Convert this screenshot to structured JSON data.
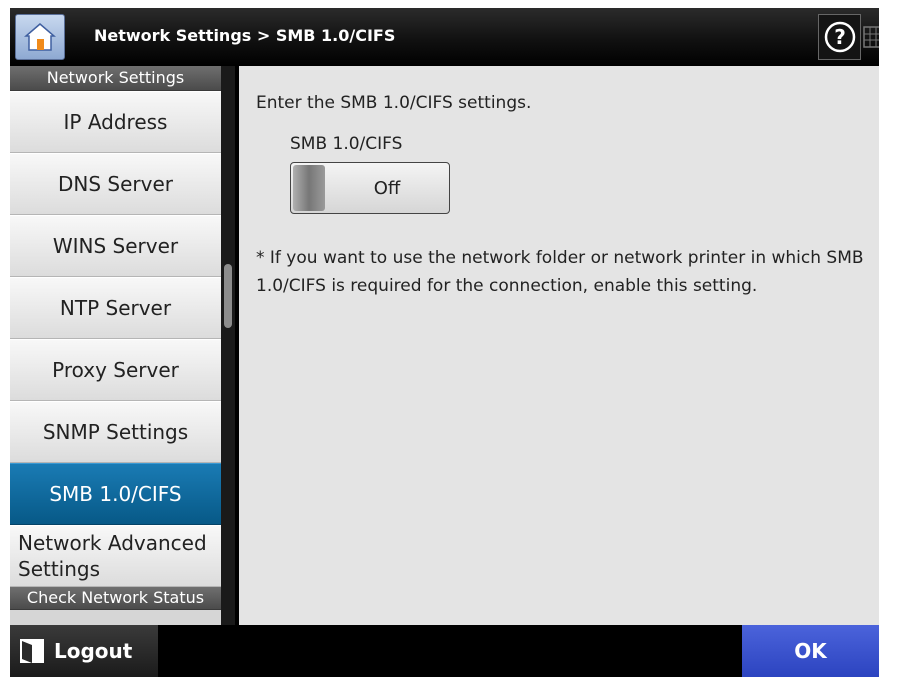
{
  "header": {
    "title": "Network Settings > SMB 1.0/CIFS",
    "home_icon": "home-icon",
    "help_icon": "help-icon",
    "keyboard_icon": "keyboard-icon"
  },
  "sidebar": {
    "group_title": "Network Settings",
    "items": [
      {
        "label": "IP Address",
        "active": false
      },
      {
        "label": "DNS Server",
        "active": false
      },
      {
        "label": "WINS Server",
        "active": false
      },
      {
        "label": "NTP Server",
        "active": false
      },
      {
        "label": "Proxy Server",
        "active": false
      },
      {
        "label": "SNMP Settings",
        "active": false
      },
      {
        "label": "SMB 1.0/CIFS",
        "active": true
      },
      {
        "label_line1": "Network Advanced",
        "label_line2": "Settings",
        "active": false
      }
    ],
    "next_group_title": "Check Network Status"
  },
  "main": {
    "intro": "Enter the SMB 1.0/CIFS settings.",
    "toggle_label": "SMB 1.0/CIFS",
    "toggle_state": "Off",
    "note": "* If you want to use the network folder or network printer in which SMB 1.0/CIFS is required for the connection, enable this setting."
  },
  "footer": {
    "logout_label": "Logout",
    "ok_label": "OK"
  },
  "colors": {
    "accent_active": "#0a6aa1",
    "ok_button": "#3a53d0",
    "header_bg": "#000000",
    "content_bg": "#e4e4e4"
  }
}
